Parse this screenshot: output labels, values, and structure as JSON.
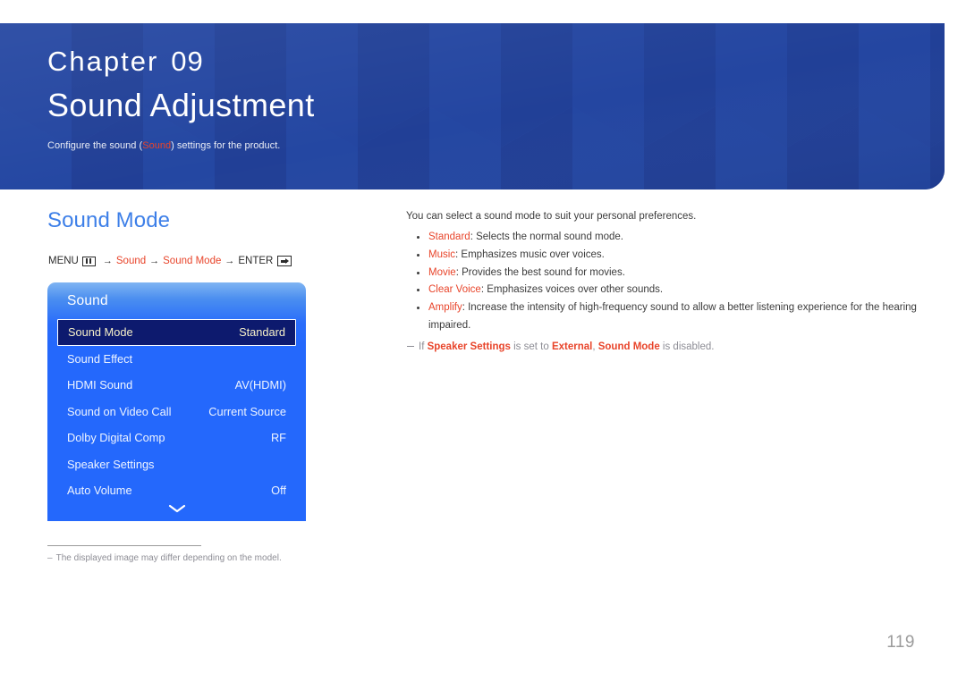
{
  "header": {
    "chapter_label": "Chapter",
    "chapter_number": "09",
    "title": "Sound Adjustment",
    "subtitle_before": "Configure the sound (",
    "subtitle_highlight": "Sound",
    "subtitle_after": ") settings for the product.",
    "bg_color": "#21409a"
  },
  "section": {
    "title": "Sound Mode",
    "title_color": "#3d7fe8",
    "menu_path": {
      "menu_label": "MENU",
      "menu_icon": "menu-grid-icon",
      "arrow": "→",
      "step1": "Sound",
      "step2": "Sound Mode",
      "enter_label": "ENTER",
      "enter_icon": "enter-return-icon",
      "highlight_color": "#e8442a"
    }
  },
  "osd": {
    "title": "Sound",
    "panel_color": "#2468fc",
    "selected_bg": "#0d1a6e",
    "selected_text": "#f6f0c8",
    "rows": [
      {
        "label": "Sound Mode",
        "value": "Standard",
        "selected": true
      },
      {
        "label": "Sound Effect",
        "value": "",
        "selected": false
      },
      {
        "label": "HDMI Sound",
        "value": "AV(HDMI)",
        "selected": false
      },
      {
        "label": "Sound on Video Call",
        "value": "Current Source",
        "selected": false
      },
      {
        "label": "Dolby Digital Comp",
        "value": "RF",
        "selected": false
      },
      {
        "label": "Speaker Settings",
        "value": "",
        "selected": false
      },
      {
        "label": "Auto Volume",
        "value": "Off",
        "selected": false
      }
    ],
    "scroll_icon": "chevron-down-icon"
  },
  "left_footnote": {
    "dash": "–",
    "text": "The displayed image may differ depending on the model."
  },
  "content": {
    "intro": "You can select a sound mode to suit your personal preferences.",
    "bullets": [
      {
        "term": "Standard",
        "desc": ": Selects the normal sound mode."
      },
      {
        "term": "Music",
        "desc": ": Emphasizes music over voices."
      },
      {
        "term": "Movie",
        "desc": ": Provides the best sound for movies."
      },
      {
        "term": "Clear Voice",
        "desc": ": Emphasizes voices over other sounds."
      },
      {
        "term": "Amplify",
        "desc": ": Increase the intensity of high-frequency sound to allow a better listening experience for the hearing impaired."
      }
    ],
    "note": {
      "p1": "If ",
      "s1": "Speaker Settings",
      "p2": " is set to ",
      "s2": "External",
      "p3": ", ",
      "s3": "Sound Mode",
      "p4": " is disabled."
    }
  },
  "page_number": "119"
}
